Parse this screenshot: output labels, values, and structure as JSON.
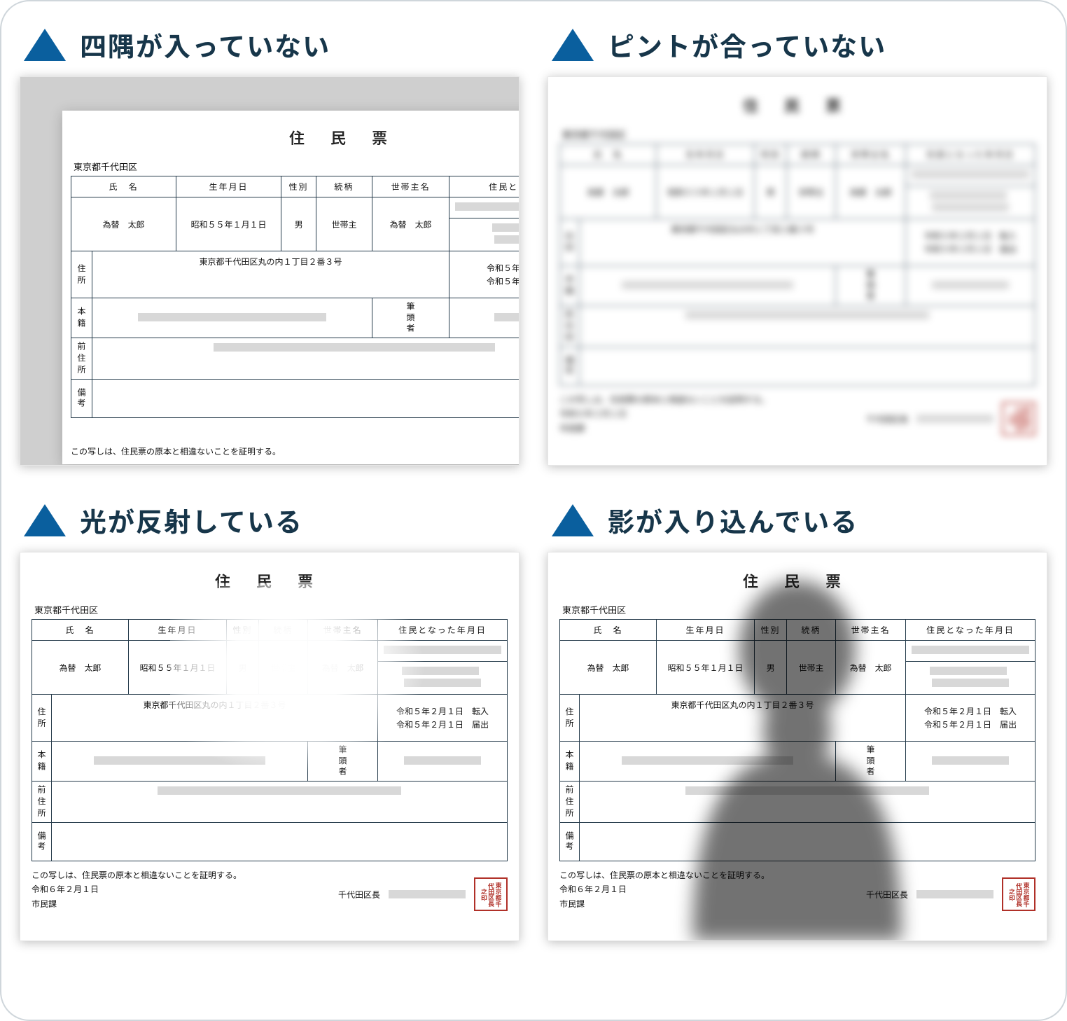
{
  "examples": [
    {
      "title": "四隅が入っていない"
    },
    {
      "title": "ピントが合っていない"
    },
    {
      "title": "光が反射している"
    },
    {
      "title": "影が入り込んでいる"
    }
  ],
  "doc": {
    "title": "住 民 票",
    "municipality": "東京都千代田区",
    "headers": {
      "name": "氏　名",
      "birth": "生年月日",
      "sex": "性別",
      "relation": "続柄",
      "head": "世帯主名",
      "became": "住民となった年月日"
    },
    "row": {
      "name": "為替　太郎",
      "birth": "昭和５５年１月１日",
      "sex": "男",
      "relation": "世帯主",
      "head": "為替　太郎"
    },
    "sideLabels": {
      "address": "住所",
      "registry": "本籍",
      "headOfReg": "筆頭者",
      "prevAddr": "前住所",
      "notes": "備考"
    },
    "address": "東京都千代田区丸の内１丁目２番３号",
    "events": {
      "moveIn": "令和５年２月１日　転入",
      "notify": "令和５年２月１日　届出"
    },
    "footer": {
      "cert": "この写しは、住民票の原本と相違ないことを証明する。",
      "date": "令和６年２月１日",
      "section": "市民課",
      "mayorLabel": "千代田区長",
      "seal": "東京都千代田区長之印"
    }
  }
}
